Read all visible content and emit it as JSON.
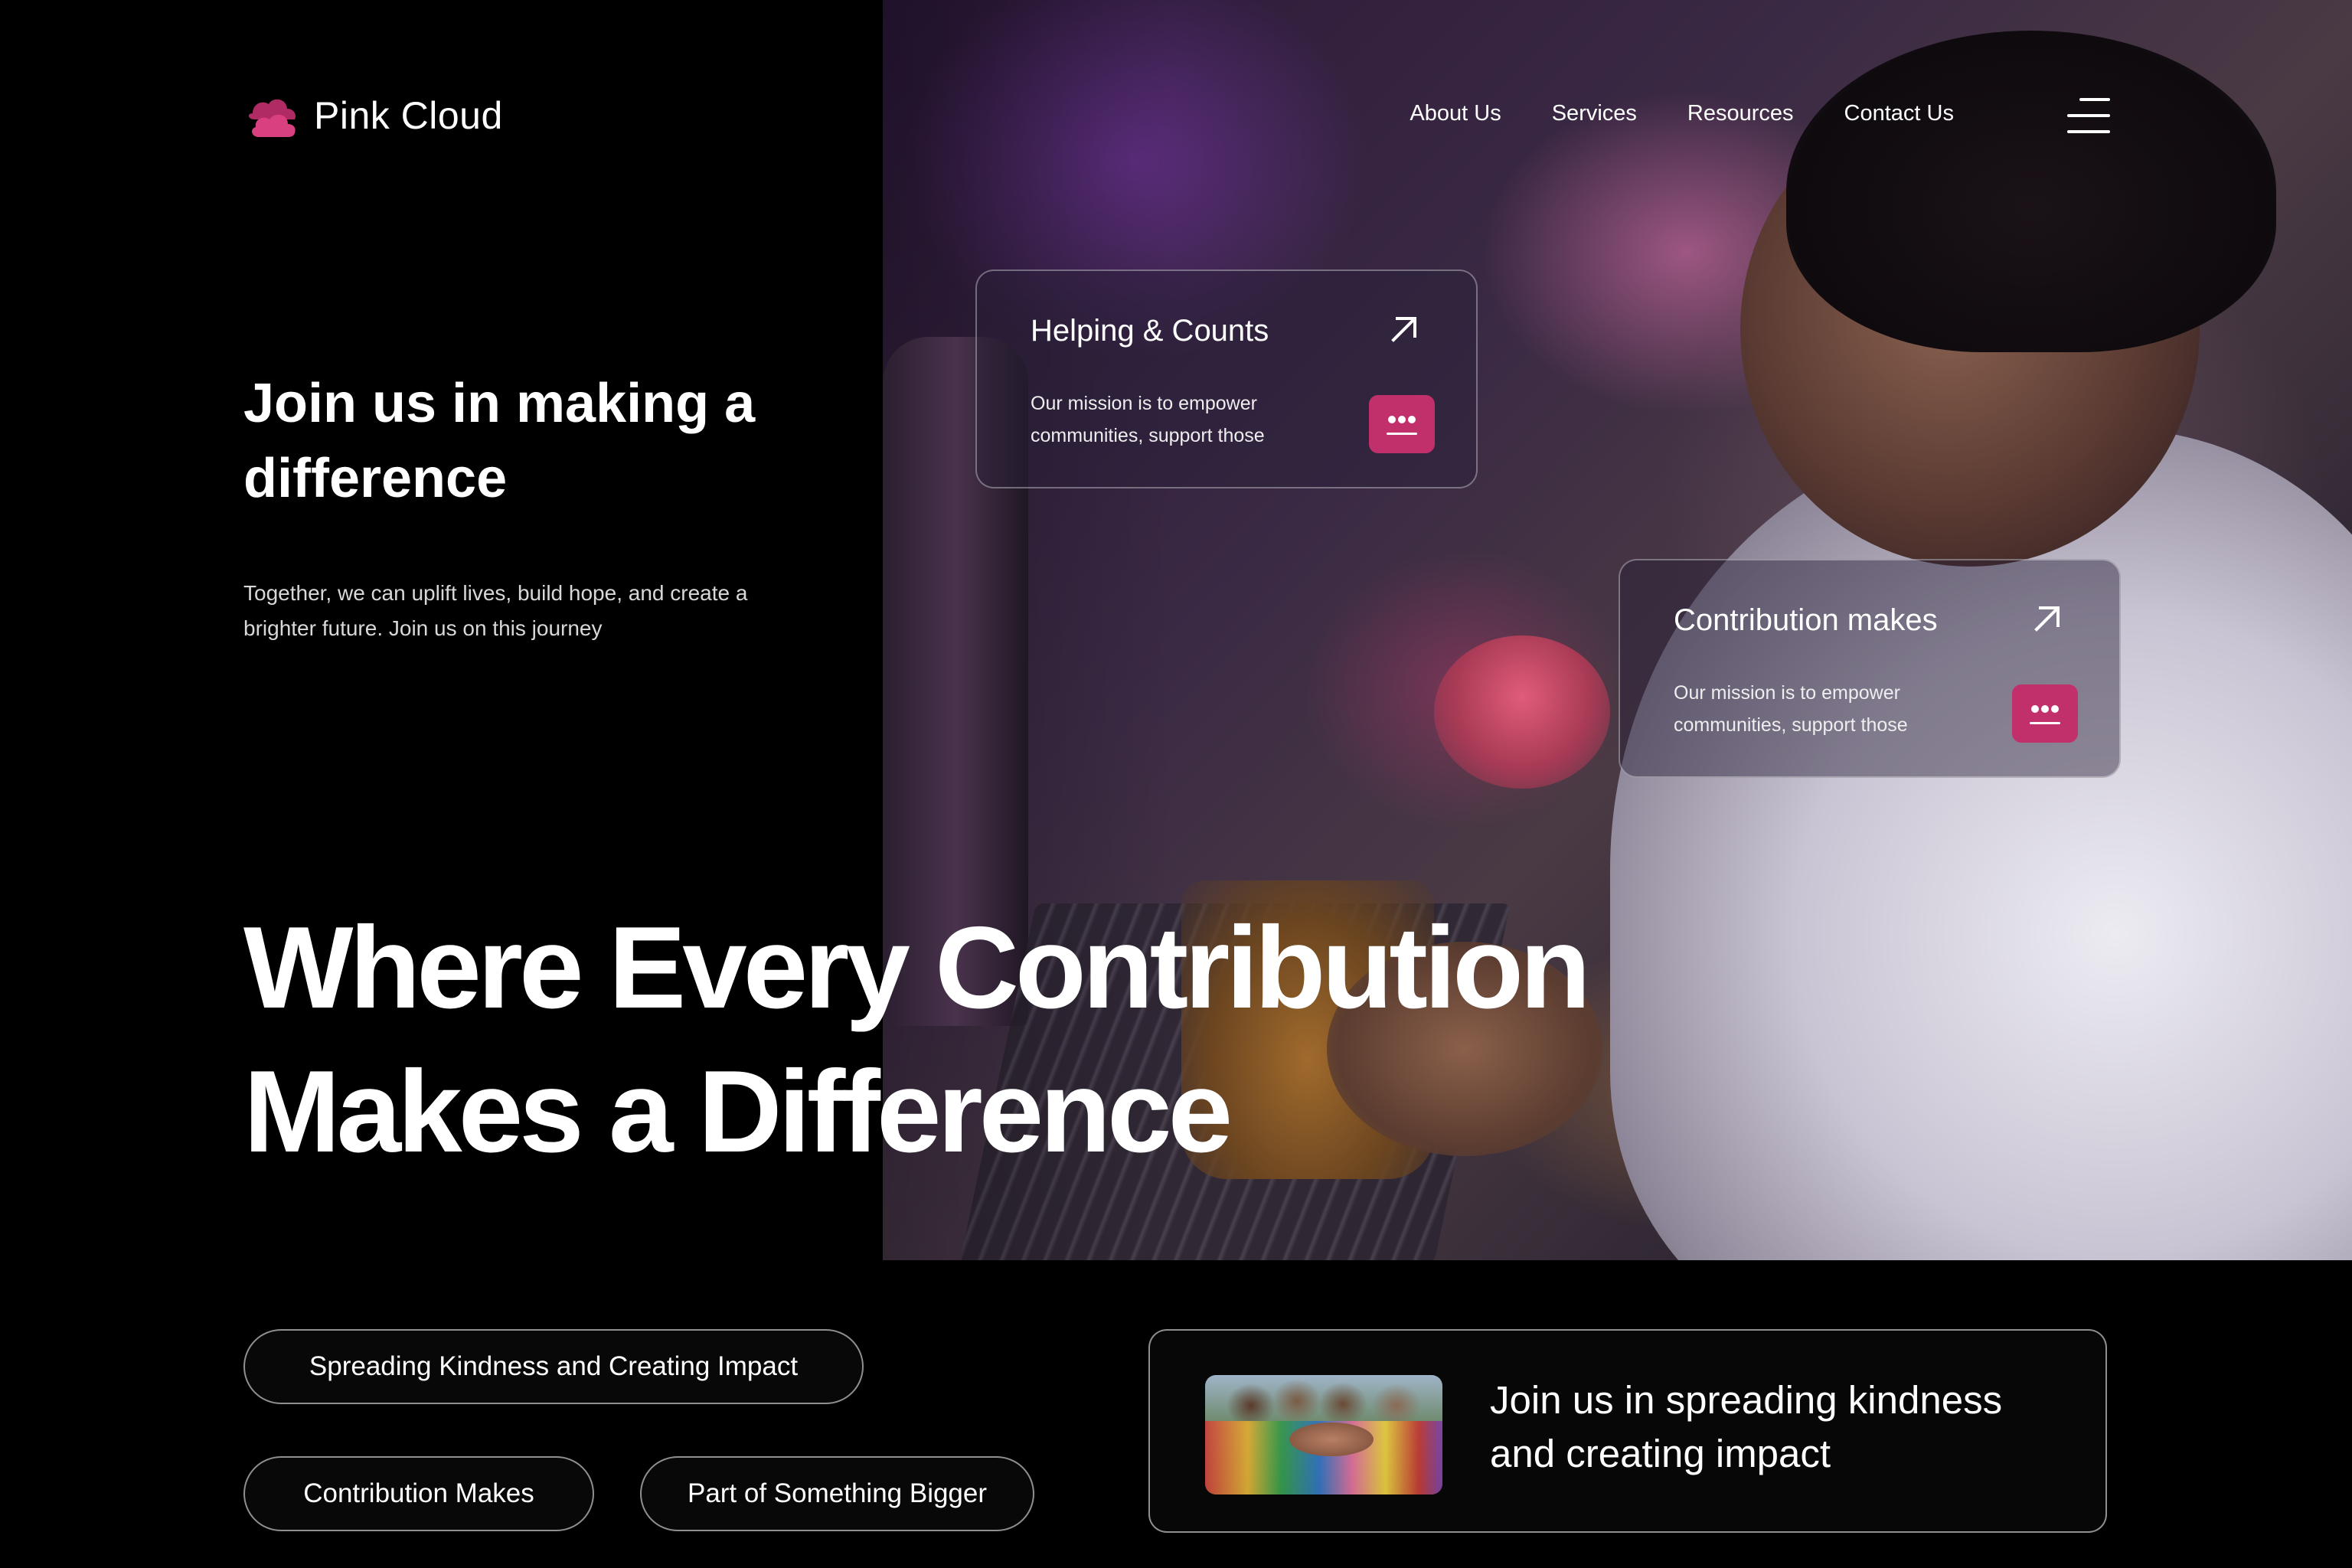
{
  "brand": {
    "name": "Pink Cloud",
    "accent": "#c2306c"
  },
  "nav": {
    "items": [
      {
        "label": "About Us"
      },
      {
        "label": "Services"
      },
      {
        "label": "Resources"
      },
      {
        "label": "Contact Us"
      }
    ],
    "menu_icon": "hamburger-menu-icon"
  },
  "intro": {
    "title": "Join us in making a difference",
    "text": "Together, we can uplift lives, build hope, and create a brighter future. Join us on this journey"
  },
  "headline": {
    "line1": "Where Every Contribution",
    "line2": "Makes a Difference"
  },
  "cards": [
    {
      "title": "Helping & Counts",
      "text": "Our mission is to empower communities, support those",
      "arrow_icon": "arrow-up-right-icon",
      "button_icon": "message-icon"
    },
    {
      "title": "Contribution makes",
      "text": "Our mission is to empower communities, support those",
      "arrow_icon": "arrow-up-right-icon",
      "button_icon": "message-icon"
    }
  ],
  "pills": [
    {
      "label": "Spreading Kindness and Creating Impact"
    },
    {
      "label": "Contribution Makes"
    },
    {
      "label": "Part of Something Bigger"
    }
  ],
  "join_card": {
    "text": "Join us in spreading kindness and creating impact"
  }
}
